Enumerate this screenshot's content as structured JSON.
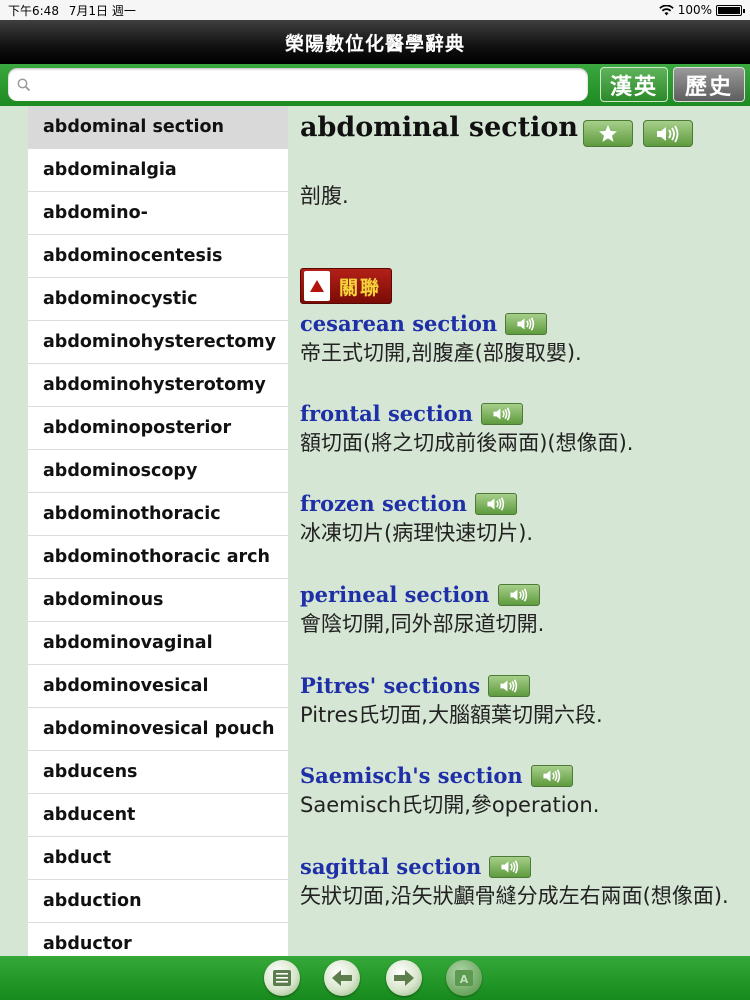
{
  "status_bar": {
    "time": "下午6:48",
    "date": "7月1日 週一",
    "battery": "100%"
  },
  "app": {
    "title": "榮陽數位化醫學辭典"
  },
  "search": {
    "placeholder": "",
    "value": ""
  },
  "top_buttons": {
    "lang": "漢英",
    "history": "歷史"
  },
  "word_list": [
    "abdominal section",
    "abdominalgia",
    "abdomino-",
    "abdominocentesis",
    "abdominocystic",
    "abdominohysterectomy",
    "abdominohysterotomy",
    "abdominoposterior",
    "abdominoscopy",
    "abdominothoracic",
    "abdominothoracic arch",
    "abdominous",
    "abdominovaginal",
    "abdominovesical",
    "abdominovesical pouch",
    "abducens",
    "abducent",
    "abduct",
    "abduction",
    "abductor"
  ],
  "selected_word_index": 0,
  "entry": {
    "headword": "abdominal section",
    "definition": "剖腹."
  },
  "related": {
    "label": "關聯",
    "items": [
      {
        "term": "cesarean section",
        "def": "帝王式切開,剖腹產(部腹取嬰)."
      },
      {
        "term": "frontal section",
        "def": "額切面(將之切成前後兩面)(想像面)."
      },
      {
        "term": "frozen section",
        "def": "冰凍切片(病理快速切片)."
      },
      {
        "term": "perineal section",
        "def": "會陰切開,同外部尿道切開."
      },
      {
        "term": "Pitres' sections",
        "def": "Pitres氏切面,大腦額葉切開六段."
      },
      {
        "term": "Saemisch's section",
        "def": "Saemisch氏切開,參operation."
      },
      {
        "term": "sagittal section",
        "def": "矢狀切面,沿矢狀顱骨縫分成左右兩面(想像面)."
      }
    ]
  },
  "icons": {
    "star": "star-icon",
    "sound": "speaker-icon",
    "related": "triangle-up-icon",
    "list": "list-icon",
    "back": "arrow-left-icon",
    "forward": "arrow-right-icon",
    "font": "font-size-icon"
  },
  "colors": {
    "bar_green": "#1d8a22",
    "term_blue": "#1e2fa8",
    "related_red": "#9a140c",
    "panel_bg": "#d6e6d4"
  }
}
